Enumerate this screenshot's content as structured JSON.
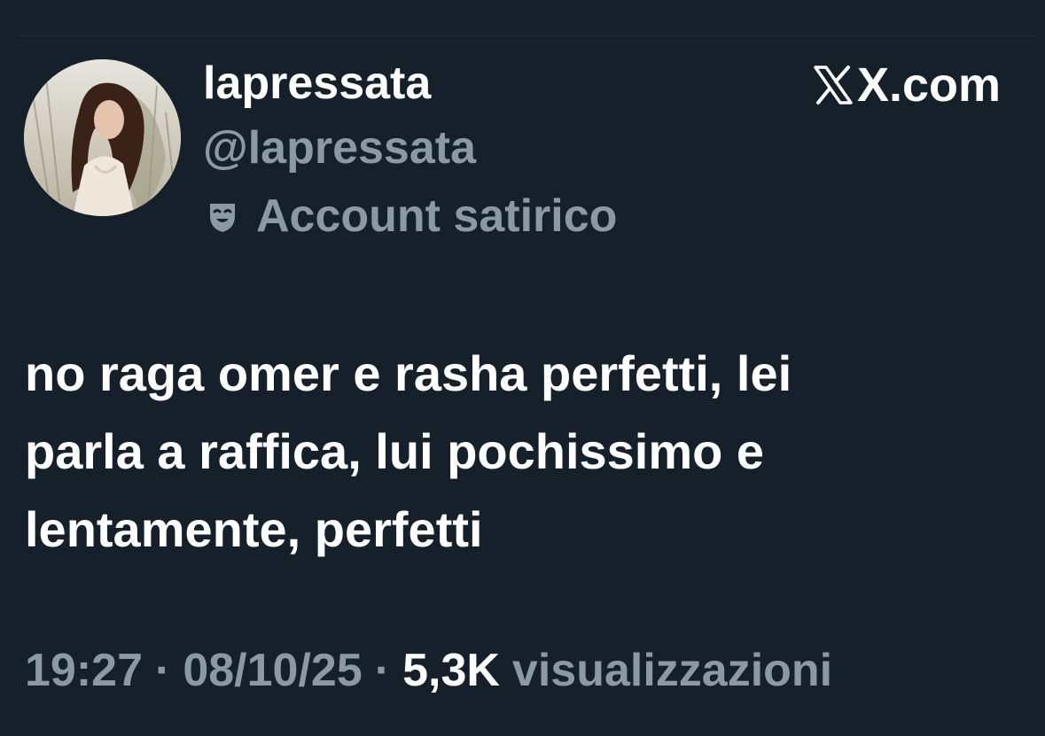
{
  "tweet": {
    "display_name": "lapressata",
    "handle": "@lapressata",
    "account_label": "Account satirico",
    "account_label_icon": "theater-mask-icon",
    "brand": "X.com",
    "brand_logo": "x-logo-icon",
    "text_lines": [
      "no raga omer e rasha perfetti, lei",
      "parla a raffica, lui pochissimo e",
      "lentamente, perfetti"
    ],
    "time": "19:27",
    "date": "08/10/25",
    "separator": "·",
    "views_count": "5,3K",
    "views_label": "visualizzazioni"
  },
  "colors": {
    "background": "#15202b",
    "primary_text": "#ffffff",
    "secondary_text": "#8b98a5"
  }
}
